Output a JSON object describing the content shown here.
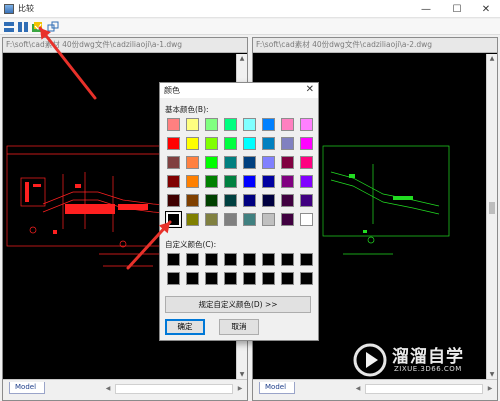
{
  "window": {
    "title": "比较",
    "controls": [
      "minimize",
      "maximize",
      "close"
    ]
  },
  "toolbar": {
    "buttons": [
      "layout-horizontal-icon",
      "layout-vertical-icon",
      "color-picker-icon",
      "compare-icon"
    ]
  },
  "panes": [
    {
      "path": "F:\\soft\\cad素材 40份dwg文件\\cadziliaoji\\a-1.dwg",
      "drawing_color": "#ff2020",
      "tab": "Model"
    },
    {
      "path": "F:\\soft\\cad素材 40份dwg文件\\cadziliaoji\\a-2.dwg",
      "drawing_color": "#22dd22",
      "tab": "Model"
    }
  ],
  "color_dialog": {
    "title": "颜色",
    "basic_colors_label": "基本颜色(B):",
    "basic_colors": [
      "#ff8080",
      "#ffff80",
      "#80ff80",
      "#00ff80",
      "#80ffff",
      "#0080ff",
      "#ff80c0",
      "#ff80ff",
      "#ff0000",
      "#ffff00",
      "#80ff00",
      "#00ff40",
      "#00ffff",
      "#0080c0",
      "#8080c0",
      "#ff00ff",
      "#804040",
      "#ff8040",
      "#00ff00",
      "#008080",
      "#004080",
      "#8080ff",
      "#800040",
      "#ff0080",
      "#800000",
      "#ff8000",
      "#008000",
      "#008040",
      "#0000ff",
      "#0000a0",
      "#800080",
      "#8000ff",
      "#400000",
      "#804000",
      "#004000",
      "#004040",
      "#000080",
      "#000040",
      "#400040",
      "#400080",
      "#000000",
      "#808000",
      "#808040",
      "#808080",
      "#408080",
      "#c0c0c0",
      "#400040",
      "#ffffff"
    ],
    "selected_index": 40,
    "custom_colors_label": "自定义颜色(C):",
    "custom_colors_count": 16,
    "define_custom_button": "规定自定义颜色(D) >>",
    "ok_button": "确定",
    "cancel_button": "取消"
  },
  "watermark": {
    "name": "溜溜自学",
    "url": "ZIXUE.3D66.COM"
  },
  "annotation_color": "#e8312a"
}
